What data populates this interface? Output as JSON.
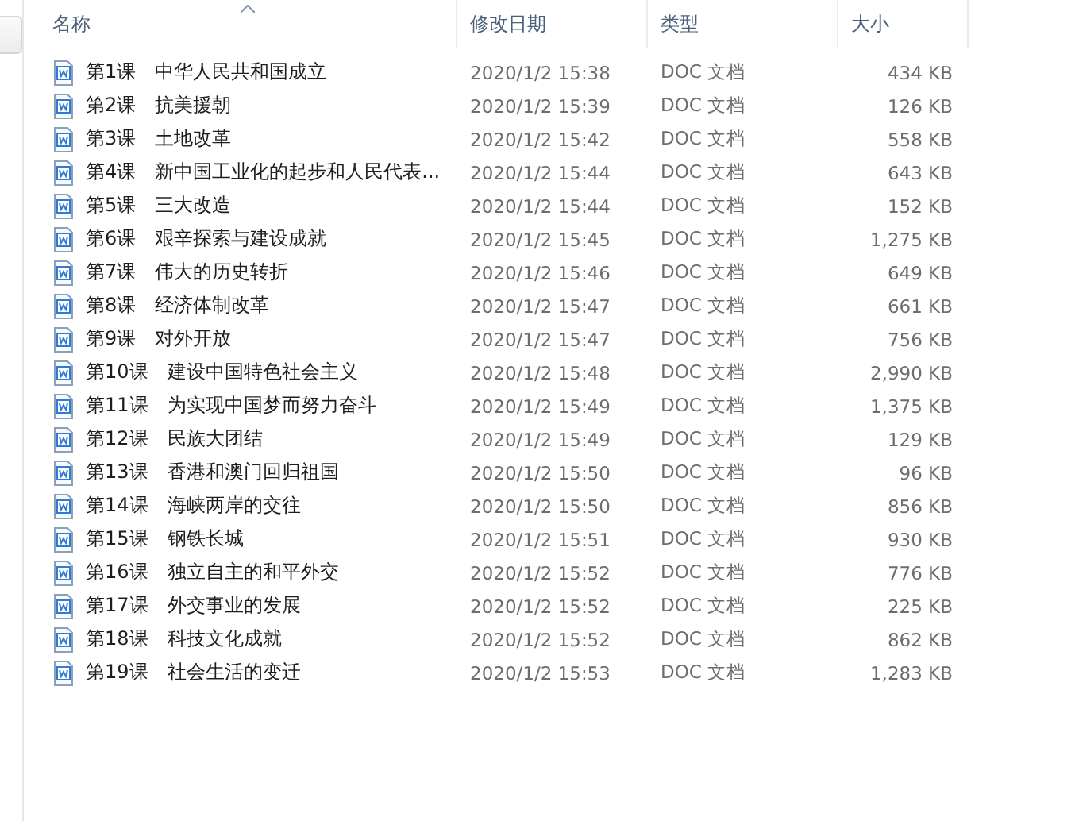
{
  "columns": [
    {
      "label": "名称",
      "sorted": true
    },
    {
      "label": "修改日期",
      "sorted": false
    },
    {
      "label": "类型",
      "sorted": false
    },
    {
      "label": "大小",
      "sorted": false
    }
  ],
  "files": [
    {
      "name": "第1课　中华人民共和国成立",
      "modified": "2020/1/2 15:38",
      "type": "DOC 文档",
      "size": "434 KB"
    },
    {
      "name": "第2课　抗美援朝",
      "modified": "2020/1/2 15:39",
      "type": "DOC 文档",
      "size": "126 KB"
    },
    {
      "name": "第3课　土地改革",
      "modified": "2020/1/2 15:42",
      "type": "DOC 文档",
      "size": "558 KB"
    },
    {
      "name": "第4课　新中国工业化的起步和人民代表...",
      "modified": "2020/1/2 15:44",
      "type": "DOC 文档",
      "size": "643 KB"
    },
    {
      "name": "第5课　三大改造",
      "modified": "2020/1/2 15:44",
      "type": "DOC 文档",
      "size": "152 KB"
    },
    {
      "name": "第6课　艰辛探索与建设成就",
      "modified": "2020/1/2 15:45",
      "type": "DOC 文档",
      "size": "1,275 KB"
    },
    {
      "name": "第7课　伟大的历史转折",
      "modified": "2020/1/2 15:46",
      "type": "DOC 文档",
      "size": "649 KB"
    },
    {
      "name": "第8课　经济体制改革",
      "modified": "2020/1/2 15:47",
      "type": "DOC 文档",
      "size": "661 KB"
    },
    {
      "name": "第9课　对外开放",
      "modified": "2020/1/2 15:47",
      "type": "DOC 文档",
      "size": "756 KB"
    },
    {
      "name": "第10课　建设中国特色社会主义",
      "modified": "2020/1/2 15:48",
      "type": "DOC 文档",
      "size": "2,990 KB"
    },
    {
      "name": "第11课　为实现中国梦而努力奋斗",
      "modified": "2020/1/2 15:49",
      "type": "DOC 文档",
      "size": "1,375 KB"
    },
    {
      "name": "第12课　民族大团结",
      "modified": "2020/1/2 15:49",
      "type": "DOC 文档",
      "size": "129 KB"
    },
    {
      "name": "第13课　香港和澳门回归祖国",
      "modified": "2020/1/2 15:50",
      "type": "DOC 文档",
      "size": "96 KB"
    },
    {
      "name": "第14课　海峡两岸的交往",
      "modified": "2020/1/2 15:50",
      "type": "DOC 文档",
      "size": "856 KB"
    },
    {
      "name": "第15课　钢铁长城",
      "modified": "2020/1/2 15:51",
      "type": "DOC 文档",
      "size": "930 KB"
    },
    {
      "name": "第16课　独立自主的和平外交",
      "modified": "2020/1/2 15:52",
      "type": "DOC 文档",
      "size": "776 KB"
    },
    {
      "name": "第17课　外交事业的发展",
      "modified": "2020/1/2 15:52",
      "type": "DOC 文档",
      "size": "225 KB"
    },
    {
      "name": "第18课　科技文化成就",
      "modified": "2020/1/2 15:52",
      "type": "DOC 文档",
      "size": "862 KB"
    },
    {
      "name": "第19课　社会生活的变迁",
      "modified": "2020/1/2 15:53",
      "type": "DOC 文档",
      "size": "1,283 KB"
    }
  ]
}
